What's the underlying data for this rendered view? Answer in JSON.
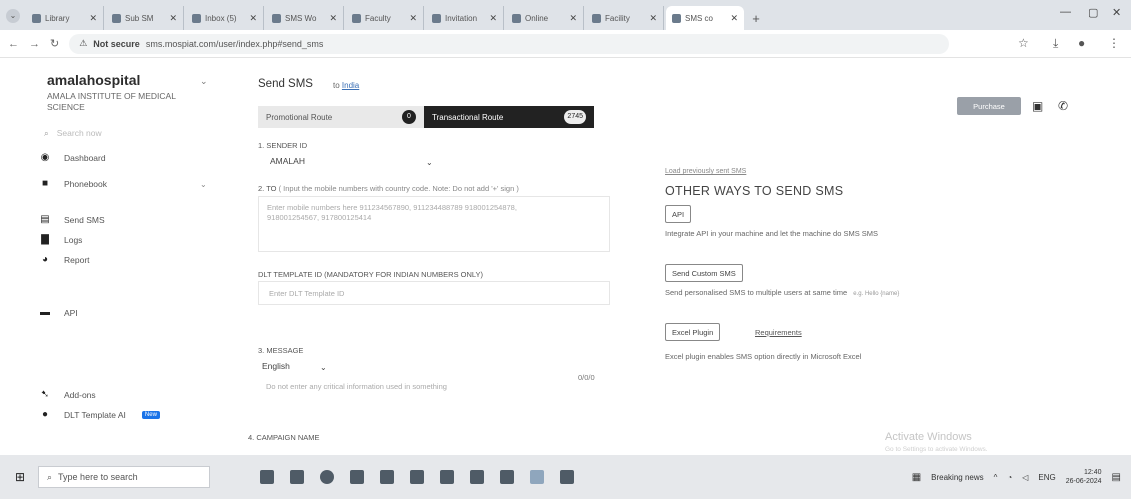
{
  "browser": {
    "tabs": [
      {
        "label": "Library",
        "active": false
      },
      {
        "label": "Sub SM",
        "active": false
      },
      {
        "label": "Inbox (5)",
        "active": false
      },
      {
        "label": "SMS Wo",
        "active": false
      },
      {
        "label": "Faculty",
        "active": false
      },
      {
        "label": "Invitation",
        "active": false
      },
      {
        "label": "Online",
        "active": false
      },
      {
        "label": "Facility",
        "active": false
      },
      {
        "label": "SMS co",
        "active": true
      }
    ],
    "new_tab": "+",
    "security_label": "Not secure",
    "url": "sms.mospiat.com/user/index.php#send_sms"
  },
  "sidebar": {
    "brand": "amalahospital",
    "subtitle": "AMALA INSTITUTE OF MEDICAL SCIENCE",
    "search_placeholder": "Search now",
    "items": [
      {
        "label": "Dashboard",
        "icon": "dashboard-icon",
        "glyph": "◉"
      },
      {
        "label": "Phonebook",
        "icon": "phonebook-icon",
        "glyph": "■"
      },
      {
        "label": "Send SMS",
        "icon": "send-sms-icon",
        "glyph": "▤"
      },
      {
        "label": "Logs",
        "icon": "logs-icon",
        "glyph": "▇"
      },
      {
        "label": "Report",
        "icon": "report-icon",
        "glyph": "◕"
      },
      {
        "label": "API",
        "icon": "api-icon",
        "glyph": "▬"
      },
      {
        "label": "Add-ons",
        "icon": "addons-icon",
        "glyph": "➷"
      },
      {
        "label": "DLT Template AI",
        "icon": "dlt-template-icon",
        "glyph": "●",
        "badge": "New"
      }
    ]
  },
  "main": {
    "title": "Send SMS",
    "country_prefix": "to",
    "country": "India",
    "routes": {
      "promotional": "Promotional Route",
      "promotional_count": "0",
      "transactional": "Transactional Route",
      "transactional_count": "2745"
    },
    "sender_label": "1. SENDER ID",
    "sender_value": "AMALAH",
    "to_label": "2. TO",
    "to_hint": "( Input the mobile numbers with country code. Note: Do not add '+' sign )",
    "to_placeholder": "Enter mobile numbers here 911234567890, 911234488789 918001254878, 918001254567, 917800125414",
    "dlt_label": "DLT TEMPLATE ID (Mandatory for Indian Numbers only)",
    "dlt_placeholder": "Enter DLT Template ID",
    "message_label": "3. MESSAGE",
    "language": "English",
    "counter": "0/0/0",
    "message_placeholder": "Do not enter any critical information used in something",
    "campaign_label": "4. CAMPAIGN NAME"
  },
  "right_panel": {
    "link": "Load previously sent SMS",
    "title": "OTHER WAYS TO SEND SMS",
    "api_button": "API",
    "api_desc": "Integrate API in your machine and let the machine do SMS SMS",
    "custom_button": "Send Custom SMS",
    "custom_desc": "Send personalised SMS to multiple users at same time",
    "custom_note": "e.g. Hello {name}",
    "excel_button": "Excel Plugin",
    "requirements": "Requirements",
    "excel_desc": "Excel plugin enables SMS option directly in Microsoft Excel",
    "purchase": "Purchase"
  },
  "watermark": {
    "title": "Activate Windows",
    "subtitle": "Go to Settings to activate Windows."
  },
  "taskbar": {
    "search_placeholder": "Type here to search",
    "news": "Breaking news",
    "lang": "ENG",
    "time": "12:40",
    "date": "26-06-2024"
  }
}
